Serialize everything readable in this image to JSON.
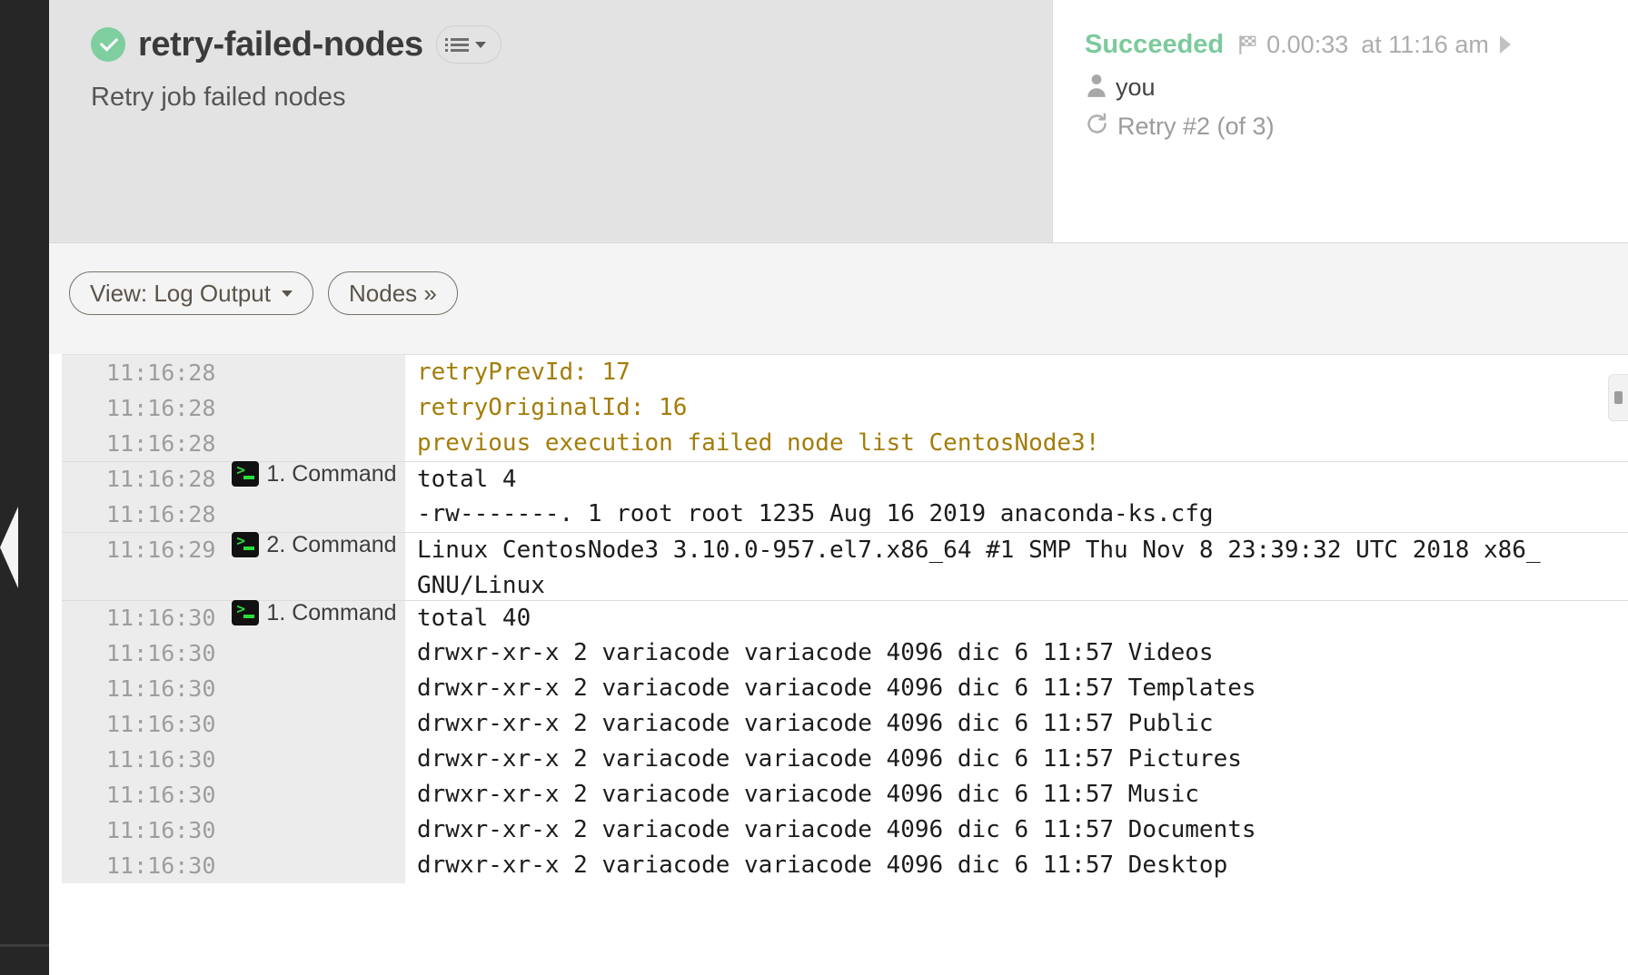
{
  "job": {
    "status_icon": "check-circle-icon",
    "title": "retry-failed-nodes",
    "description": "Retry job failed nodes",
    "menu_icon": "list-menu-icon",
    "menu_caret_icon": "caret-down-icon"
  },
  "status": {
    "state": "Succeeded",
    "flag_icon": "checkered-flag-icon",
    "duration": "0.00:33",
    "at_time": "at 11:16 am",
    "chevron_icon": "chevron-right-icon",
    "user_icon": "user-icon",
    "user": "you",
    "retry_icon": "retry-refresh-icon",
    "retry": "Retry #2 (of 3)"
  },
  "toolbar": {
    "view_button": "View: Log Output",
    "view_caret_icon": "caret-down-icon",
    "nodes_button": "Nodes »"
  },
  "log": {
    "edge_tab_icon": "panel-toggle-icon",
    "rows": [
      {
        "time": "11:16:28",
        "cmd": "",
        "text": "retryPrevId: 17",
        "warn": true,
        "sep": false,
        "tall": false
      },
      {
        "time": "11:16:28",
        "cmd": "",
        "text": "retryOriginalId: 16",
        "warn": true,
        "sep": false,
        "tall": false
      },
      {
        "time": "11:16:28",
        "cmd": "",
        "text": "previous execution failed node list CentosNode3!",
        "warn": true,
        "sep": false,
        "tall": false
      },
      {
        "time": "11:16:28",
        "cmd": "1. Command",
        "text": "total 4",
        "warn": false,
        "sep": true,
        "tall": false
      },
      {
        "time": "11:16:28",
        "cmd": "",
        "text": "-rw-------. 1 root root 1235 Aug 16  2019 anaconda-ks.cfg",
        "warn": false,
        "sep": false,
        "tall": false
      },
      {
        "time": "11:16:29",
        "cmd": "2. Command",
        "text": "Linux CentosNode3 3.10.0-957.el7.x86_64 #1 SMP Thu Nov 8 23:39:32 UTC 2018 x86_\nGNU/Linux",
        "warn": false,
        "sep": true,
        "tall": true
      },
      {
        "time": "11:16:30",
        "cmd": "1. Command",
        "text": "total 40",
        "warn": false,
        "sep": true,
        "tall": false
      },
      {
        "time": "11:16:30",
        "cmd": "",
        "text": "drwxr-xr-x 2 variacode variacode 4096 dic  6 11:57 Videos",
        "warn": false,
        "sep": false,
        "tall": false
      },
      {
        "time": "11:16:30",
        "cmd": "",
        "text": "drwxr-xr-x 2 variacode variacode 4096 dic  6 11:57 Templates",
        "warn": false,
        "sep": false,
        "tall": false
      },
      {
        "time": "11:16:30",
        "cmd": "",
        "text": "drwxr-xr-x 2 variacode variacode 4096 dic  6 11:57 Public",
        "warn": false,
        "sep": false,
        "tall": false
      },
      {
        "time": "11:16:30",
        "cmd": "",
        "text": "drwxr-xr-x 2 variacode variacode 4096 dic  6 11:57 Pictures",
        "warn": false,
        "sep": false,
        "tall": false
      },
      {
        "time": "11:16:30",
        "cmd": "",
        "text": "drwxr-xr-x 2 variacode variacode 4096 dic  6 11:57 Music",
        "warn": false,
        "sep": false,
        "tall": false
      },
      {
        "time": "11:16:30",
        "cmd": "",
        "text": "drwxr-xr-x 2 variacode variacode 4096 dic  6 11:57 Documents",
        "warn": false,
        "sep": false,
        "tall": false
      },
      {
        "time": "11:16:30",
        "cmd": "",
        "text": "drwxr-xr-x 2 variacode variacode 4096 dic  6 11:57 Desktop",
        "warn": false,
        "sep": false,
        "tall": false
      }
    ]
  },
  "colors": {
    "success_green": "#7cca9c",
    "badge_green": "#7fce9f",
    "warn_yellow": "#a37d09",
    "header_bg": "#e3e3e3",
    "toolbar_bg": "#f4f4f4",
    "rail_dark": "#262626"
  }
}
